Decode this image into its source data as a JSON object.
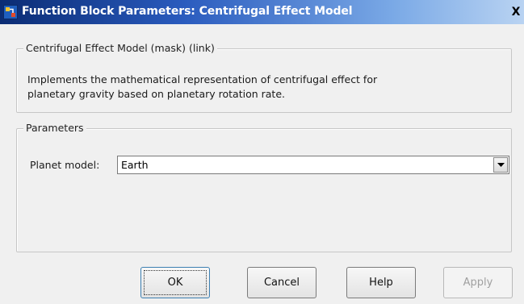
{
  "window": {
    "title": "Function Block Parameters: Centrifugal Effect Model",
    "close_glyph": "X",
    "icons": {
      "app": "simulink-block-icon",
      "close": "close-icon"
    }
  },
  "mask_group": {
    "legend": "Centrifugal Effect Model (mask) (link)",
    "description_lines": [
      "Implements the mathematical representation of centrifugal effect for",
      "planetary gravity based on planetary rotation rate."
    ]
  },
  "params_group": {
    "legend": "Parameters",
    "planet_model": {
      "label": "Planet model:",
      "value": "Earth"
    }
  },
  "buttons": {
    "ok": "OK",
    "cancel": "Cancel",
    "help": "Help",
    "apply": "Apply"
  },
  "colors": {
    "title_start": "#0b2c74",
    "title_end": "#b9d3f2",
    "dialog_bg": "#f0f0f0"
  }
}
